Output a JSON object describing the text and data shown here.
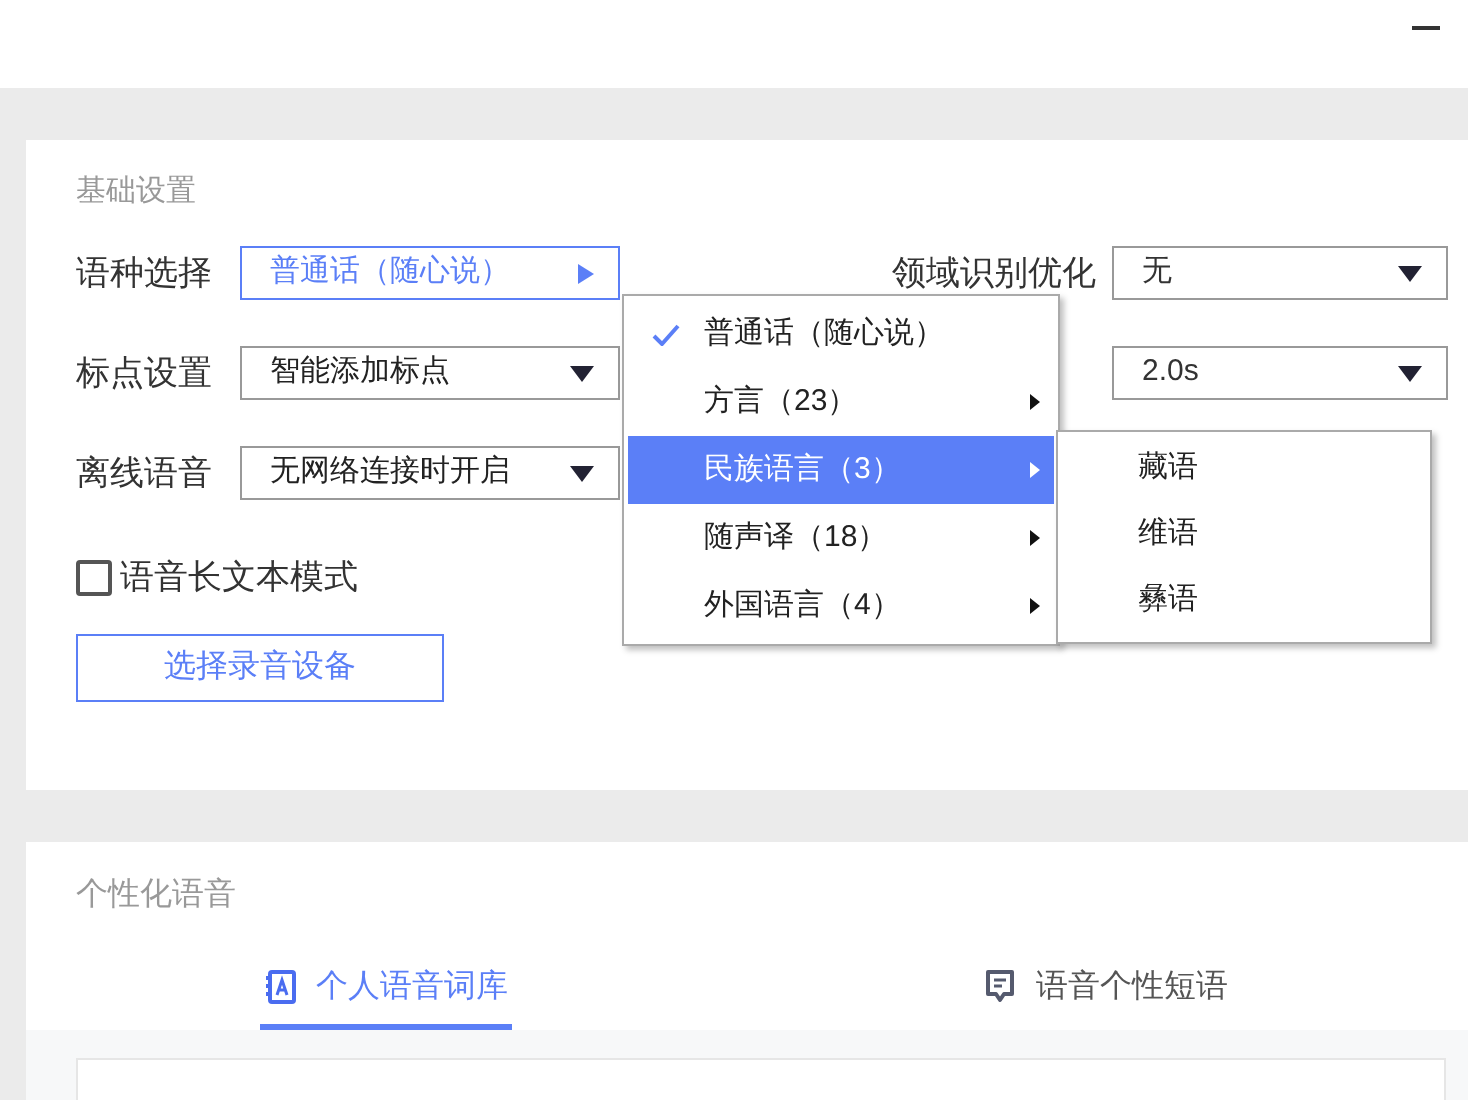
{
  "basic": {
    "title": "基础设置",
    "left_rows": [
      {
        "label": "语种选择",
        "value": "普通话（随心说）",
        "kind": "submenu",
        "active": true
      },
      {
        "label": "标点设置",
        "value": "智能添加标点",
        "kind": "dropdown",
        "active": false
      },
      {
        "label": "离线语音",
        "value": "无网络连接时开启",
        "kind": "dropdown",
        "active": false
      }
    ],
    "right_rows": [
      {
        "label": "领域识别优化",
        "value": "无"
      },
      {
        "value": "2.0s"
      }
    ],
    "long_text_mode": {
      "label": "语音长文本模式",
      "checked": false
    },
    "device_button": "选择录音设备"
  },
  "language_menu": {
    "items": [
      {
        "label": "普通话（随心说）",
        "checked": true,
        "selected": false,
        "has_submenu": false
      },
      {
        "label": "方言（23）",
        "checked": false,
        "selected": false,
        "has_submenu": true
      },
      {
        "label": "民族语言（3）",
        "checked": false,
        "selected": true,
        "has_submenu": true
      },
      {
        "label": "随声译（18）",
        "checked": false,
        "selected": false,
        "has_submenu": true
      },
      {
        "label": "外国语言（4）",
        "checked": false,
        "selected": false,
        "has_submenu": true
      }
    ],
    "submenu": [
      {
        "label": "藏语"
      },
      {
        "label": "维语"
      },
      {
        "label": "彝语"
      }
    ]
  },
  "personal": {
    "title": "个性化语音",
    "tabs": [
      {
        "label": "个人语音词库",
        "selected": true,
        "kind": "lexicon"
      },
      {
        "label": "语音个性短语",
        "selected": false,
        "kind": "phrase"
      }
    ]
  }
}
